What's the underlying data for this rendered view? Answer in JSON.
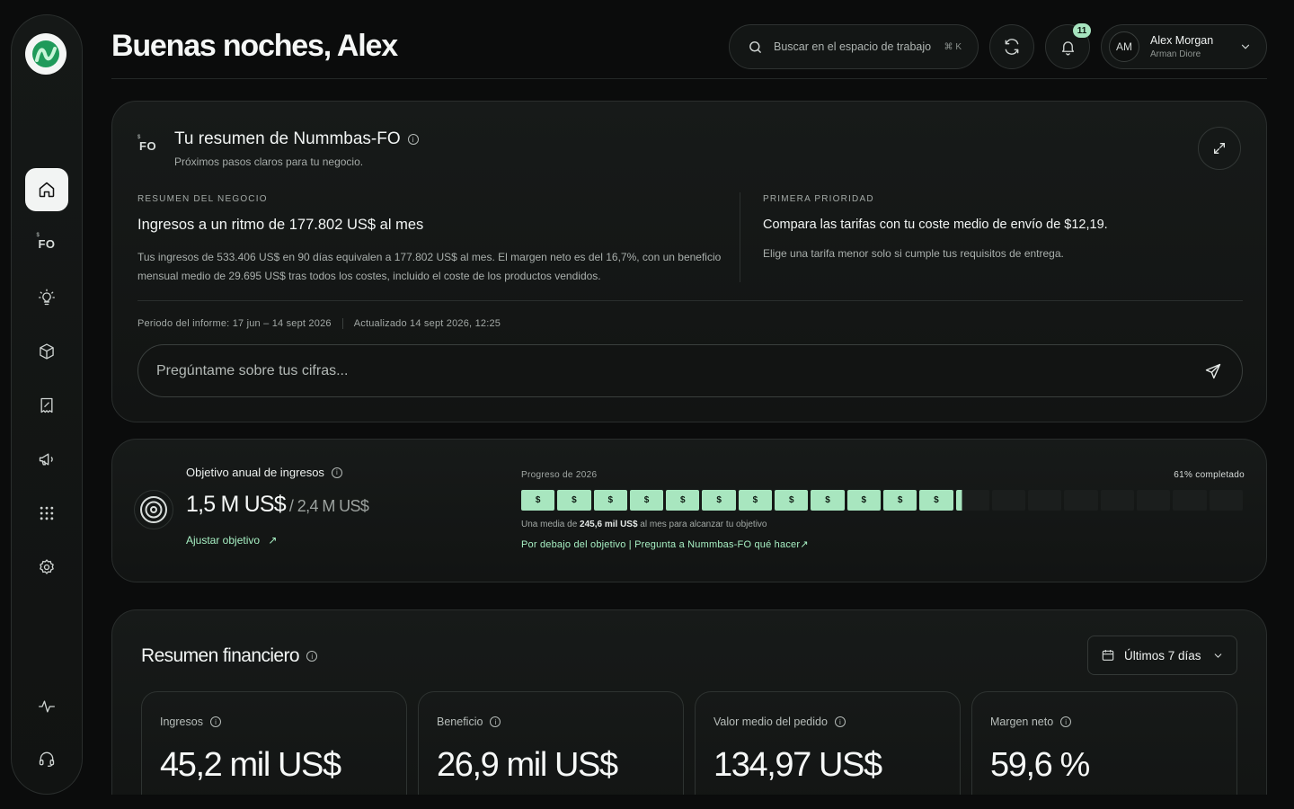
{
  "header": {
    "greeting": "Buenas noches, Alex",
    "search_placeholder": "Buscar en el espacio de trabajo",
    "search_shortcut": "⌘ K",
    "notifications_count": "11",
    "user": {
      "initials": "AM",
      "name": "Alex Morgan",
      "subtitle": "Arman Diore"
    }
  },
  "sidebar": {
    "items": [
      {
        "name": "home",
        "icon": "home-icon",
        "active": true
      },
      {
        "name": "fo",
        "icon": "fo-logo-icon",
        "label": "FO"
      },
      {
        "name": "insights",
        "icon": "lightbulb-icon"
      },
      {
        "name": "products",
        "icon": "box-icon"
      },
      {
        "name": "reports",
        "icon": "receipt-icon"
      },
      {
        "name": "marketing",
        "icon": "megaphone-icon"
      },
      {
        "name": "apps",
        "icon": "grid-dots-icon"
      },
      {
        "name": "settings",
        "icon": "gear-icon"
      },
      {
        "name": "activity",
        "icon": "pulse-icon"
      },
      {
        "name": "support",
        "icon": "headset-icon"
      }
    ]
  },
  "summary": {
    "title": "Tu resumen de Nummbas-FO",
    "subtitle": "Próximos pasos claros para tu negocio.",
    "left": {
      "eyebrow": "RESUMEN DEL NEGOCIO",
      "headline": "Ingresos a un ritmo de 177.802 US$ al mes",
      "body": "Tus ingresos de 533.406 US$ en 90 días equivalen a 177.802 US$ al mes. El margen neto es del 16,7%, con un beneficio mensual medio de 29.695 US$ tras todos los costes, incluido el coste de los productos vendidos."
    },
    "right": {
      "eyebrow": "PRIMERA PRIORIDAD",
      "headline": "Compara las tarifas con tu coste medio de envío de $12,19.",
      "body": "Elige una tarifa menor solo si cumple tus requisitos de entrega."
    },
    "period": "Periodo del informe: 17 jun – 14 sept 2026",
    "updated": "Actualizado 14 sept 2026, 12:25",
    "ask_placeholder": "Pregúntame sobre tus cifras..."
  },
  "goal": {
    "title": "Objetivo anual de ingresos",
    "current": "1,5 M US$",
    "target": "/ 2,4 M US$",
    "adjust_label": "Ajustar objetivo",
    "progress_label": "Progreso de 2026",
    "progress_pct_label": "61% completado",
    "progress_fraction": 0.61,
    "block_symbol": "$",
    "note_prefix": "Una media de ",
    "note_amount": "245,6 mil US$",
    "note_suffix": " al mes para alcanzar tu objetivo",
    "link": "Por debajo del objetivo | Pregunta a Nummbas-FO qué hacer↗"
  },
  "financial": {
    "title": "Resumen financiero",
    "range": "Últimos 7 días",
    "kpis": [
      {
        "label": "Ingresos",
        "value": "45,2 mil US$"
      },
      {
        "label": "Beneficio",
        "value": "26,9 mil US$"
      },
      {
        "label": "Valor medio del pedido",
        "value": "134,97 US$"
      },
      {
        "label": "Margen neto",
        "value": "59,6 %"
      }
    ]
  },
  "colors": {
    "accent": "#a8e6bf",
    "background": "#0b0c0c"
  }
}
